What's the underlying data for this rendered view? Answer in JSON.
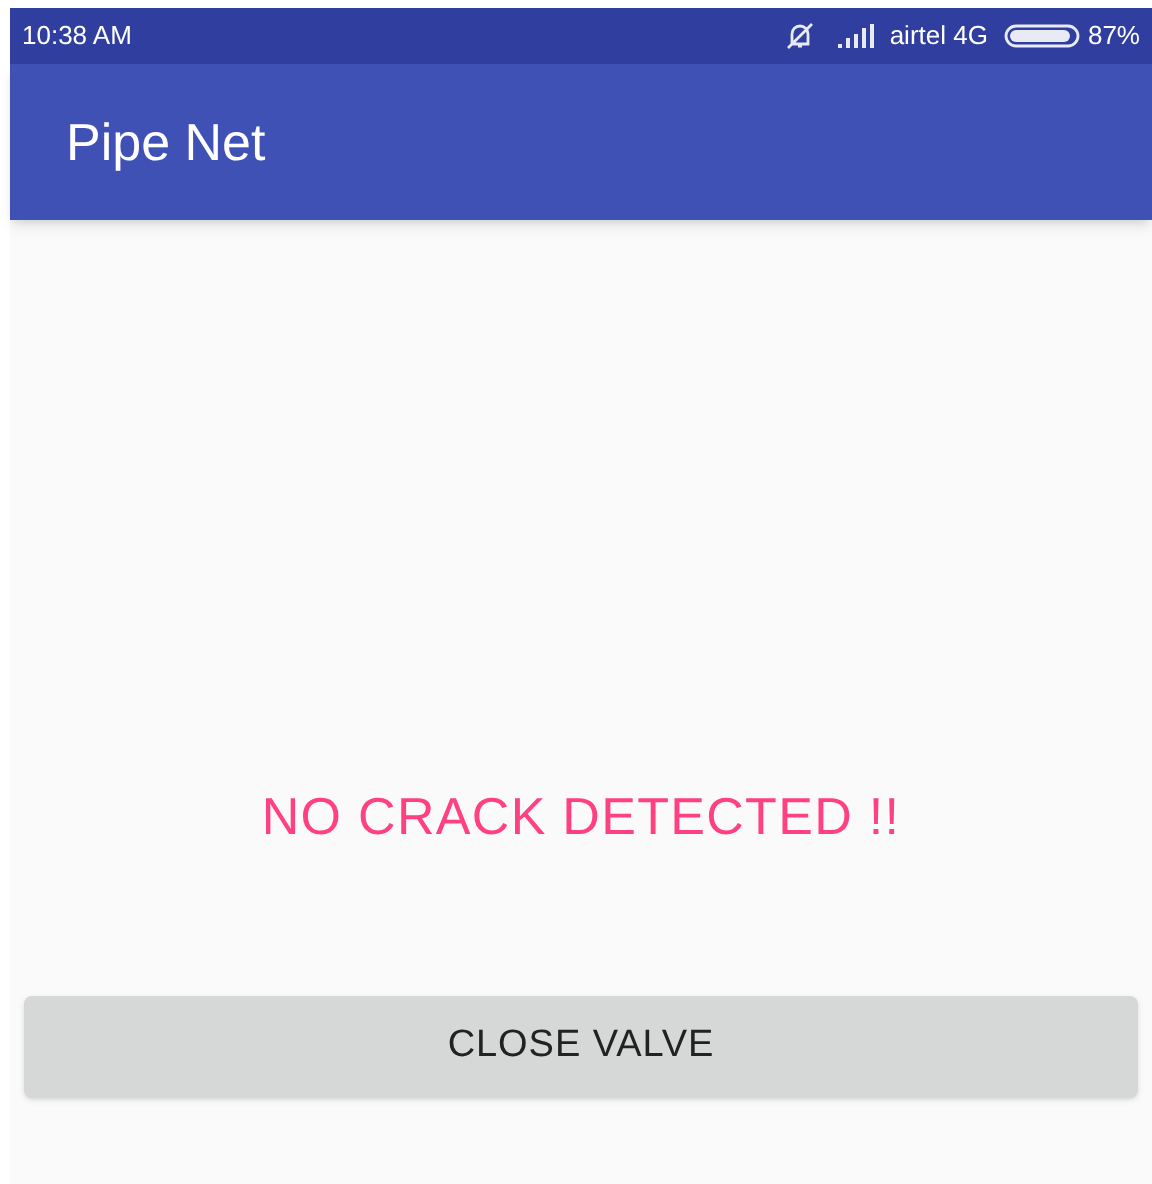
{
  "status_bar": {
    "time": "10:38 AM",
    "carrier": "airtel 4G",
    "battery": "87%"
  },
  "app_bar": {
    "title": "Pipe Net"
  },
  "message": "NO CRACK DETECTED !!",
  "button": {
    "label": "CLOSE VALVE"
  }
}
